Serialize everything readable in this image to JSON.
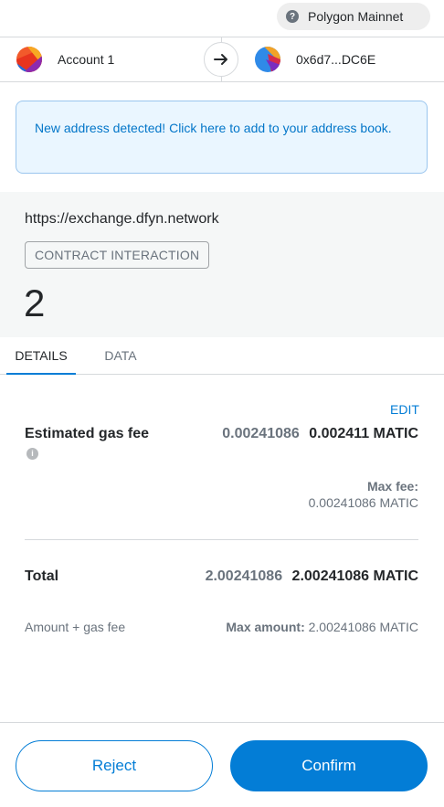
{
  "network": {
    "name": "Polygon Mainnet",
    "icon": "question-icon"
  },
  "accounts": {
    "from_name": "Account 1",
    "to_address": "0x6d7...DC6E",
    "arrow_icon": "arrow-right-icon"
  },
  "notice": {
    "text": "New address detected! Click here to add to your address book."
  },
  "transaction": {
    "origin": "https://exchange.dfyn.network",
    "method": "CONTRACT INTERACTION",
    "amount": "2"
  },
  "tabs": {
    "details": "DETAILS",
    "data": "DATA"
  },
  "edit_label": "EDIT",
  "gas": {
    "label": "Estimated gas fee",
    "secondary": "0.00241086",
    "primary": "0.002411 MATIC",
    "max_fee_label": "Max fee:",
    "max_fee_value": "0.00241086 MATIC"
  },
  "total": {
    "label": "Total",
    "secondary": "2.00241086",
    "primary": "2.00241086 MATIC",
    "sub_label": "Amount + gas fee",
    "max_amount_label": "Max amount:",
    "max_amount_value": "2.00241086 MATIC"
  },
  "buttons": {
    "reject": "Reject",
    "confirm": "Confirm"
  },
  "colors": {
    "accent": "#037dd6",
    "notice_bg": "#eaf6ff",
    "notice_text": "#0376c9"
  }
}
